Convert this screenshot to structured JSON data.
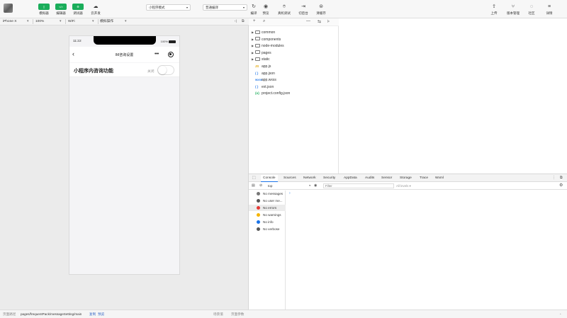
{
  "toolbar": {
    "mode_buttons": [
      {
        "label": "模拟器",
        "icon": "phone-icon",
        "glyph": "▯"
      },
      {
        "label": "编辑器",
        "icon": "code-icon",
        "glyph": "</>"
      },
      {
        "label": "调试器",
        "icon": "debug-icon",
        "glyph": "⚙"
      }
    ],
    "cloud": {
      "label": "云开发",
      "glyph": "☁"
    },
    "mode_select": "小程序模式",
    "compile_select": "普通编译",
    "actions": [
      {
        "label": "编译",
        "glyph": "↻"
      },
      {
        "label": "预览",
        "glyph": "◉"
      },
      {
        "label": "真机调试",
        "glyph": "⌾"
      },
      {
        "label": "切后台",
        "glyph": "⇥"
      },
      {
        "label": "清缓存",
        "glyph": "⊜"
      }
    ],
    "right_actions": [
      {
        "label": "上传",
        "glyph": "⇪"
      },
      {
        "label": "版本管理",
        "glyph": "⑂"
      },
      {
        "label": "社区",
        "glyph": "◌"
      },
      {
        "label": "详情",
        "glyph": "≡"
      }
    ]
  },
  "simulator": {
    "device": "iPhone X",
    "zoom": "100%",
    "network": "WiFi",
    "ops": "模拟操作",
    "status_time": "11:22",
    "battery": "100%",
    "nav_title": "IM咨询设置",
    "back_glyph": "‹",
    "setting": {
      "label": "小程序内咨询功能",
      "state": "关闭",
      "enabled": false
    }
  },
  "filetree": {
    "toolbar_glyphs": [
      "+",
      "⌕",
      "—",
      "⇆",
      "⊧"
    ],
    "items": [
      {
        "name": "common",
        "type": "folder"
      },
      {
        "name": "components",
        "type": "folder"
      },
      {
        "name": "node-modules",
        "type": "folder"
      },
      {
        "name": "pages",
        "type": "folder"
      },
      {
        "name": "static",
        "type": "folder"
      },
      {
        "name": "app.js",
        "type": "js",
        "badge": "JS",
        "color": "#e0a400"
      },
      {
        "name": "app.json",
        "type": "json",
        "badge": "{ }",
        "color": "#2b7de9"
      },
      {
        "name": "app.wxss",
        "type": "wxss",
        "badge": "wxss",
        "color": "#2b7de9"
      },
      {
        "name": "ext.json",
        "type": "json",
        "badge": "{ }",
        "color": "#2b7de9"
      },
      {
        "name": "project.config.json",
        "type": "json",
        "badge": "{o}",
        "color": "#1aad5a"
      }
    ]
  },
  "devtools": {
    "tabs": [
      "Console",
      "Sources",
      "Network",
      "Security",
      "AppData",
      "Audits",
      "Sensor",
      "Storage",
      "Trace",
      "Wxml"
    ],
    "active_tab": "Console",
    "context": "top",
    "filter_placeholder": "Filter",
    "levels": "All levels ▾",
    "prompt": "›",
    "sidebar": [
      {
        "label": "No messages",
        "color": "#777777",
        "active": false
      },
      {
        "label": "No user me...",
        "color": "#555555",
        "active": false
      },
      {
        "label": "No errors",
        "color": "#e53935",
        "active": true
      },
      {
        "label": "No warnings",
        "color": "#f5b400",
        "active": false
      },
      {
        "label": "No info",
        "color": "#1a73e8",
        "active": false
      },
      {
        "label": "No verbose",
        "color": "#555555",
        "active": false
      }
    ]
  },
  "statusbar": {
    "path_label": "页面路径",
    "path": "pages/frequentPack/messageSetting/main",
    "copy": "复制",
    "preview": "预览",
    "scene": "场景值",
    "params": "页面参数"
  }
}
